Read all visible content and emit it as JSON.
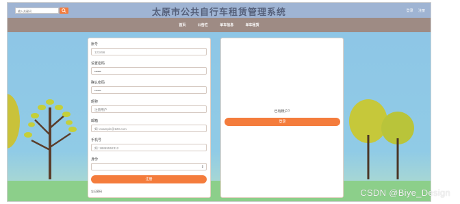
{
  "header": {
    "search_placeholder": "输入关键词",
    "site_title": "太原市公共自行车租赁管理系统",
    "login_link": "登录",
    "register_link": "注册"
  },
  "nav": {
    "items": [
      "首页",
      "公告栏",
      "单车信息",
      "单车租赁"
    ]
  },
  "register_form": {
    "fields": [
      {
        "label": "账号",
        "value": "123456"
      },
      {
        "label": "设置密码",
        "value": "••••••"
      },
      {
        "label": "确认密码",
        "value": "••••••"
      },
      {
        "label": "昵称",
        "value": "注册用户"
      },
      {
        "label": "邮箱",
        "value": "如: example@123.com"
      },
      {
        "label": "手机号",
        "value": "如: 18865552312"
      },
      {
        "label": "身份",
        "value": ""
      }
    ],
    "register_button": "注册",
    "small_link": "忘记密码"
  },
  "login_panel": {
    "prompt": "已有账户?",
    "login_button": "登录"
  },
  "watermark": "CSDN @Biye_Design"
}
